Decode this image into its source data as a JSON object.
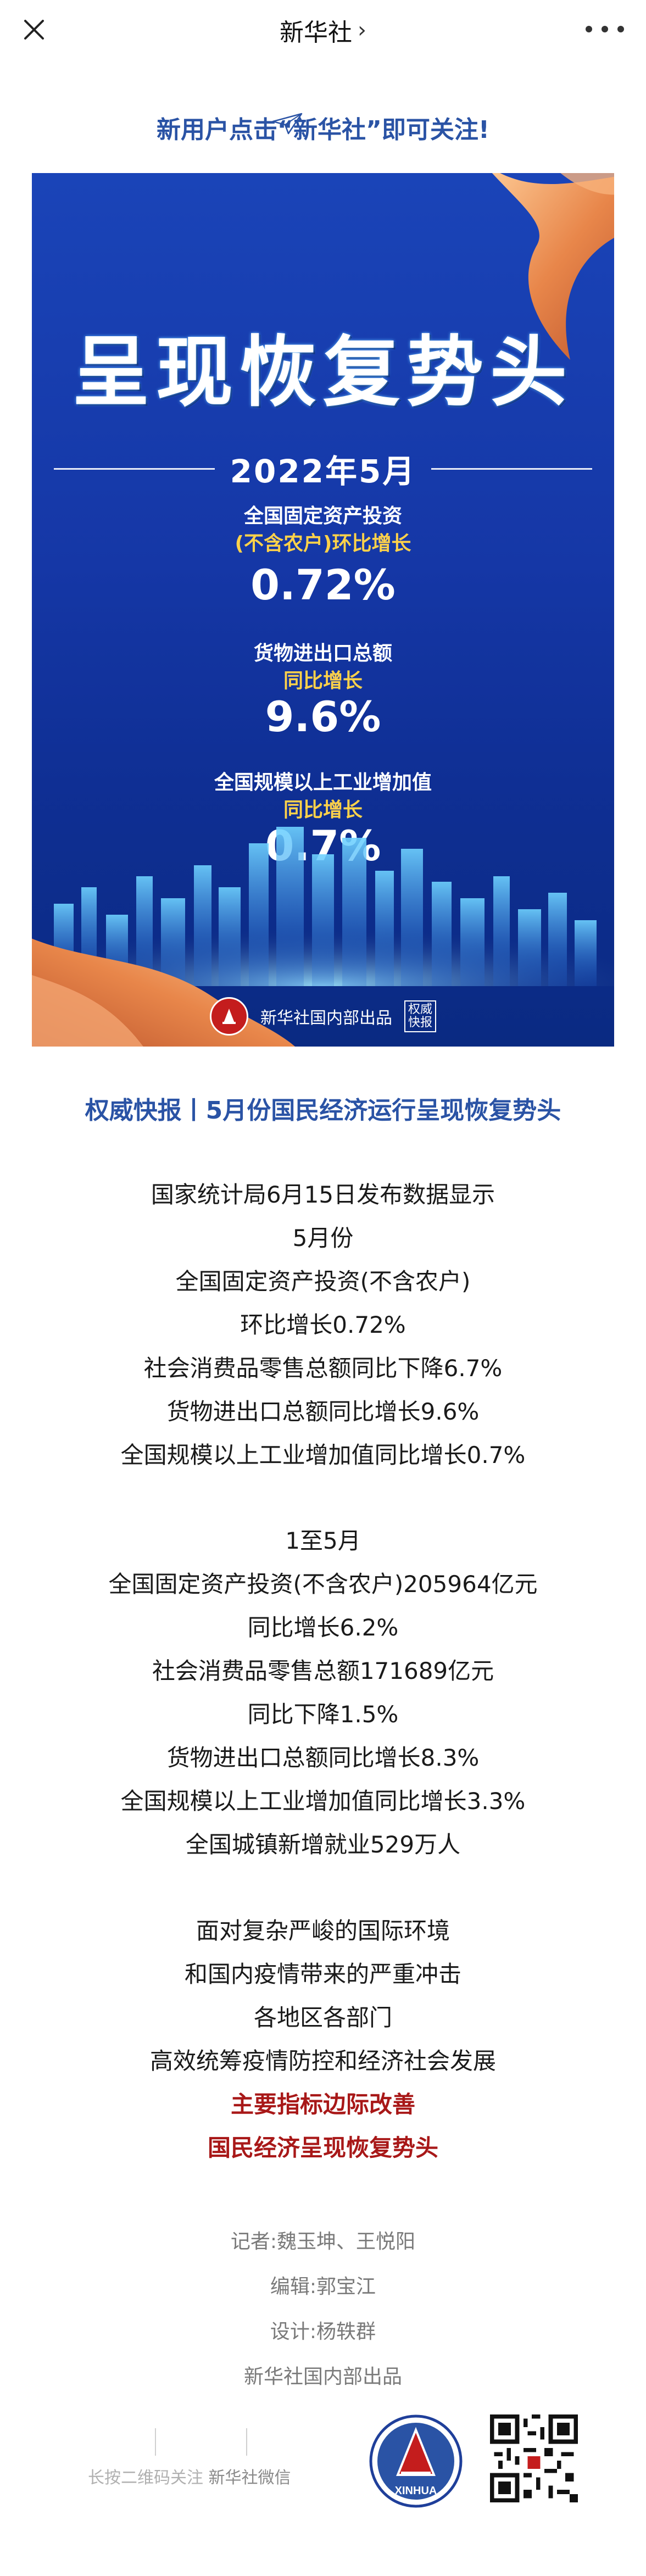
{
  "nav": {
    "title": "新华社",
    "chevron": "›"
  },
  "follow_text": "新用户点击“新华社”即可关注!",
  "poster": {
    "headline": "呈现恢复势头",
    "date": "2022年5月",
    "stats": [
      {
        "label_line1": "全国固定资产投资",
        "label_line2": "(不含农户)环比增长",
        "value": "0.72%"
      },
      {
        "label_line1": "货物进出口总额",
        "label_line2": "同比增长",
        "value": "9.6%"
      },
      {
        "label_line1": "全国规模以上工业增加值",
        "label_line2": "同比增长",
        "value": "0.7%"
      }
    ],
    "footer_text": "新华社国内部出品",
    "stamp_text": "权威快报"
  },
  "article_title": "权威快报丨5月份国民经济运行呈现恢复势头",
  "section1": [
    "国家统计局6月15日发布数据显示",
    "5月份",
    "全国固定资产投资(不含农户)",
    "环比增长0.72%",
    "社会消费品零售总额同比下降6.7%",
    "货物进出口总额同比增长9.6%",
    "全国规模以上工业增加值同比增长0.7%"
  ],
  "section2": [
    "1至5月",
    "全国固定资产投资(不含农户)205964亿元",
    "同比增长6.2%",
    "社会消费品零售总额171689亿元",
    "同比下降1.5%",
    "货物进出口总额同比增长8.3%",
    "全国规模以上工业增加值同比增长3.3%",
    "全国城镇新增就业529万人"
  ],
  "section3": [
    "面对复杂严峻的国际环境",
    "和国内疫情带来的严重冲击",
    "各地区各部门",
    "高效统筹疫情防控和经济社会发展"
  ],
  "section3_highlight": [
    "主要指标边际改善",
    "国民经济呈现恢复势头"
  ],
  "credits": {
    "reporter": "记者:魏玉坤、王悦阳",
    "editor": "编辑:郭宝江",
    "designer": "设计:杨轶群",
    "producer": "新华社国内部出品"
  },
  "bottom": {
    "hint_prefix": "长按二维码关注",
    "hint_brand": "新华社微信",
    "logo_text": "XINHUA"
  },
  "colors": {
    "accent": "#2a53a5",
    "poster_blue": "#1537a6",
    "highlight_red": "#a81818",
    "stat_yellow": "#ffd24a"
  }
}
